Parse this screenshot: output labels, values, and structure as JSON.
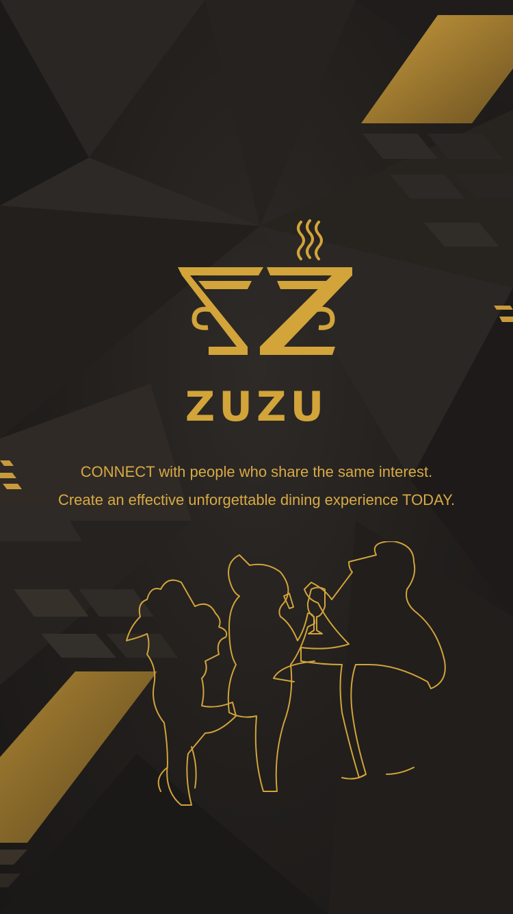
{
  "app": {
    "name": "ZUZU",
    "tagline_line1": "CONNECT with people who share the same interest.",
    "tagline_line2": "Create an effective unforgettable dining experience TODAY."
  },
  "icons": {
    "logo": "steaming-teacup-z-logo-icon",
    "illustration": "diners-at-table-line-illustration"
  },
  "colors": {
    "background": "#1e1b1a",
    "accent_gold": "#d2a43a",
    "text_gold": "#d8aa45"
  }
}
